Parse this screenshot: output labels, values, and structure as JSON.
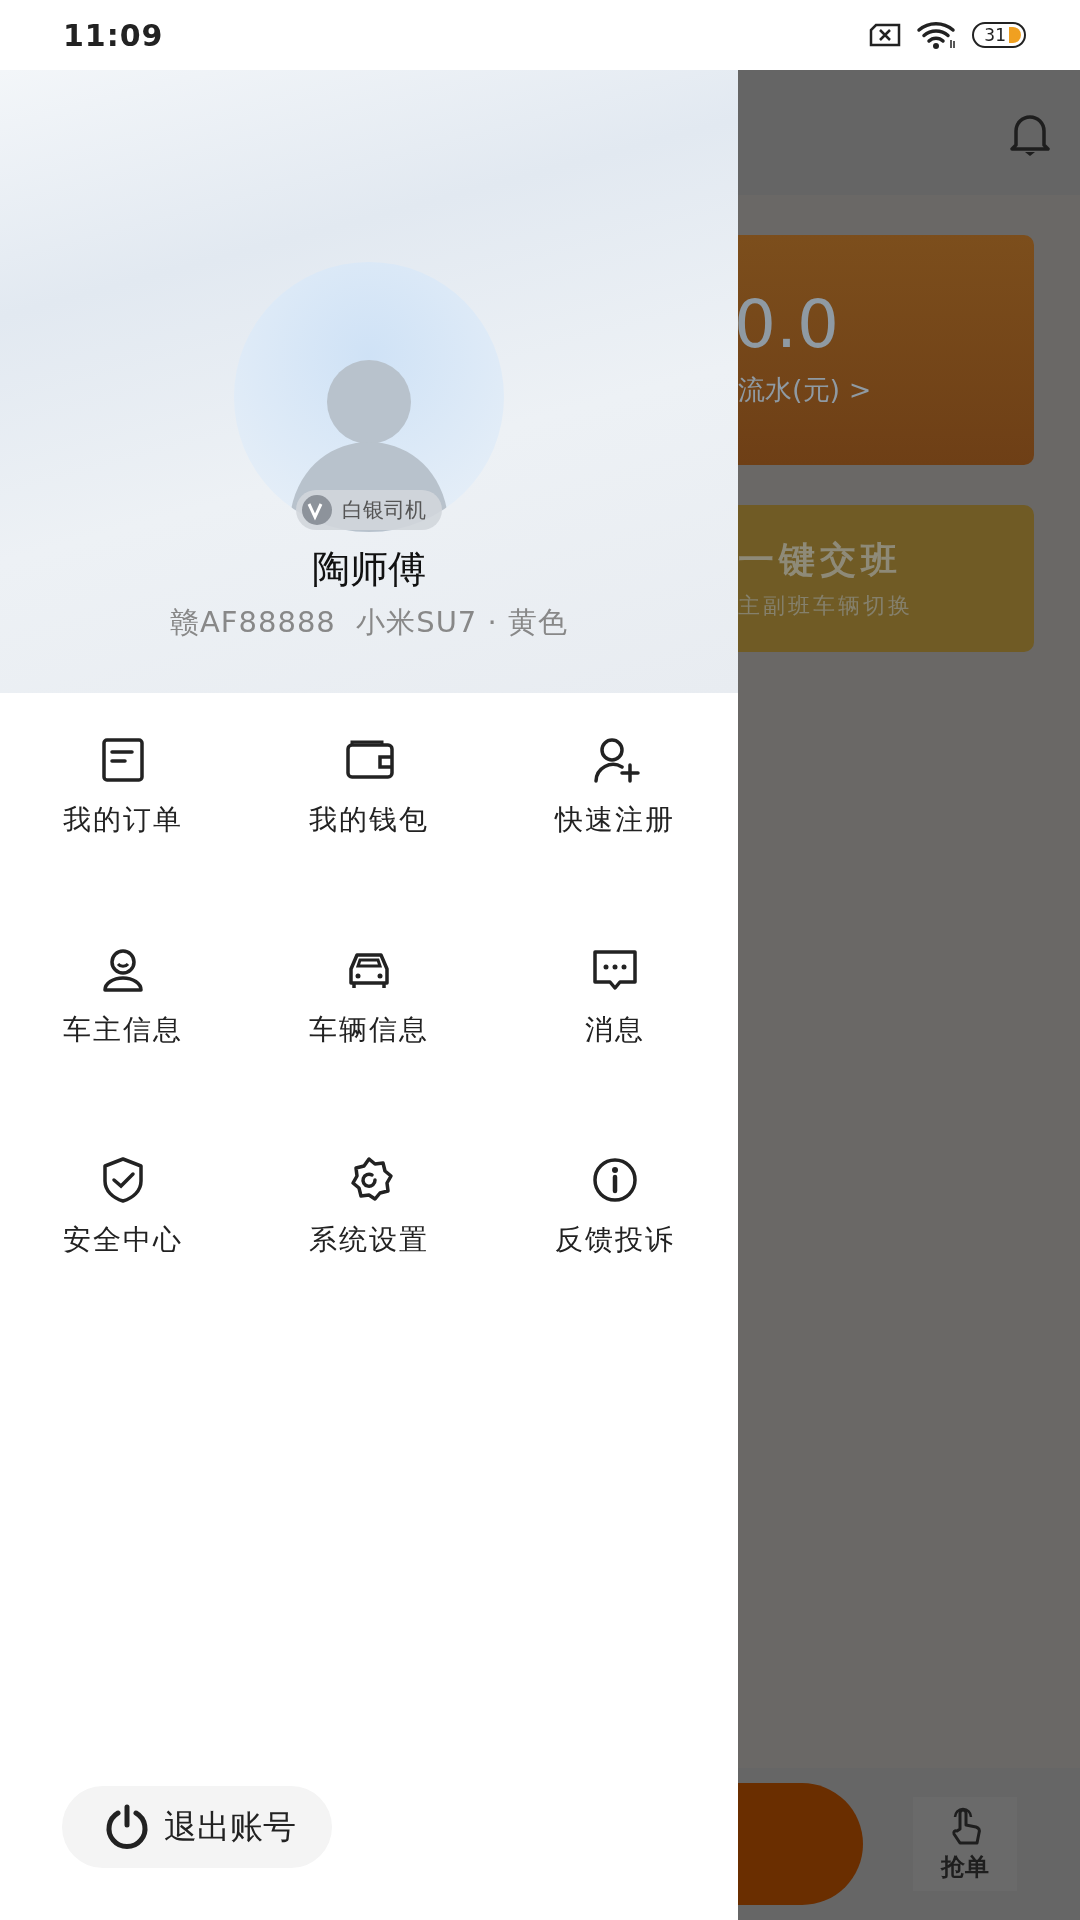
{
  "status_bar": {
    "time": "11:09",
    "battery": "31"
  },
  "drawer": {
    "profile": {
      "level_badge": "白银司机",
      "name": "陶师傅",
      "vehicle": "赣AF88888  小米SU7 · 黄色"
    },
    "menu": [
      {
        "label": "我的订单"
      },
      {
        "label": "我的钱包"
      },
      {
        "label": "快速注册"
      },
      {
        "label": "车主信息"
      },
      {
        "label": "车辆信息"
      },
      {
        "label": "消息"
      },
      {
        "label": "安全中心"
      },
      {
        "label": "系统设置"
      },
      {
        "label": "反馈投诉"
      }
    ],
    "logout": "退出账号"
  },
  "background_page": {
    "earnings_amount": "0.0",
    "earnings_label": "流水(元) >",
    "handover_title": "一键交班",
    "handover_subtitle": "主副班车辆切换",
    "bottom_tab": "抢单"
  }
}
